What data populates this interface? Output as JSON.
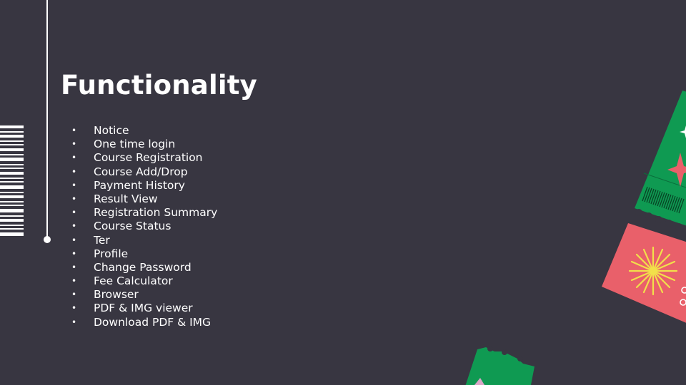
{
  "slide": {
    "title": "Functionality",
    "features": [
      "Notice",
      "One time login",
      "Course Registration",
      "Course Add/Drop",
      "Payment History",
      "Result View",
      "Registration Summary",
      "Course Status",
      "Ter",
      "Profile",
      "Change Password",
      "Fee Calculator",
      "Browser",
      "PDF & IMG viewer",
      "Download PDF & IMG"
    ]
  },
  "colors": {
    "background": "#383641",
    "text": "#ffffff",
    "ticket_green": "#0f9a52",
    "ticket_pink": "#e9606a",
    "burst_yellow": "#f2e04a"
  },
  "decorations": [
    "barcode-stripe",
    "green-ticket",
    "pink-ticket",
    "sunburst",
    "star-icon"
  ]
}
